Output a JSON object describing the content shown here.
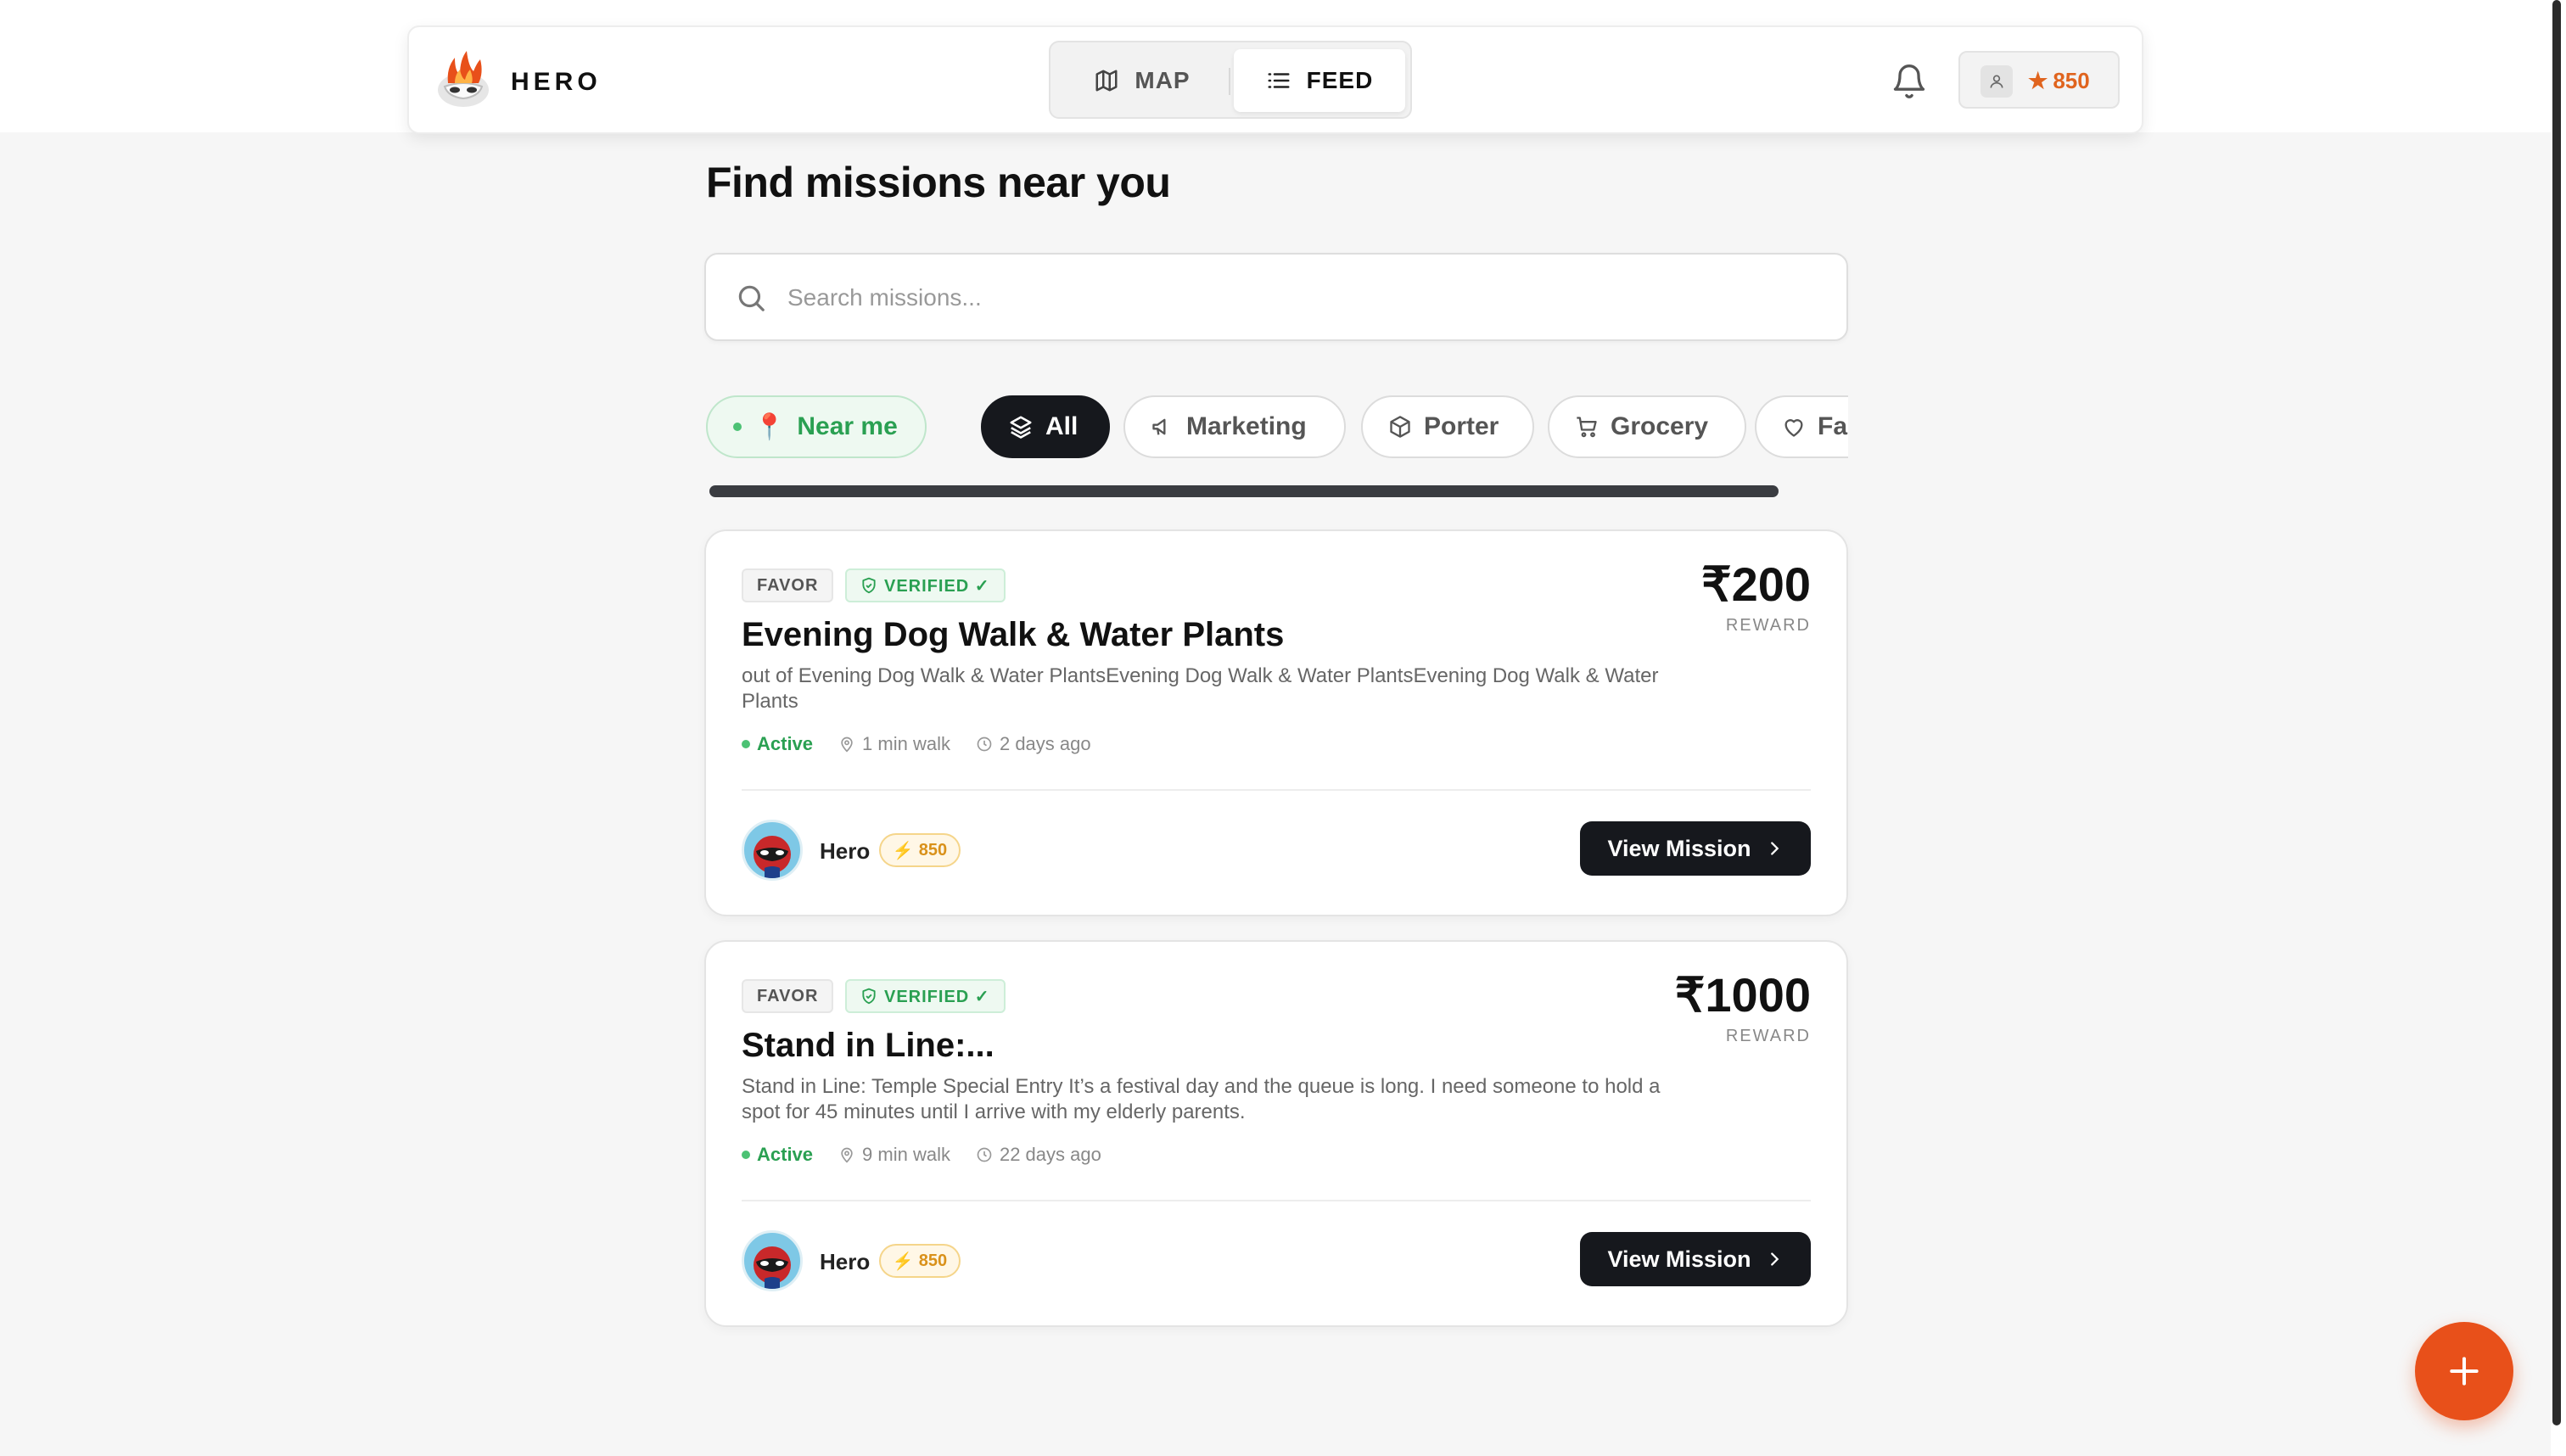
{
  "nav": {
    "brand": "HERO",
    "tabs": [
      {
        "label": "MAP",
        "icon": "map-icon"
      },
      {
        "label": "FEED",
        "icon": "list-icon",
        "active": true
      }
    ],
    "points": "850"
  },
  "heading": "Find missions near you",
  "search": {
    "placeholder": "Search missions..."
  },
  "filters": [
    {
      "label": "Near me",
      "icon": "pin-icon"
    },
    {
      "label": "All",
      "icon": "layers-icon",
      "active": true
    },
    {
      "label": "Marketing",
      "icon": "megaphone-icon"
    },
    {
      "label": "Porter",
      "icon": "box-icon"
    },
    {
      "label": "Grocery",
      "icon": "cart-icon"
    },
    {
      "label": "Fa",
      "icon": "heart-icon"
    }
  ],
  "missions": [
    {
      "category": "FAVOR",
      "verified": "VERIFIED ✓",
      "title": "Evening Dog Walk & Water Plants",
      "description": "out of Evening Dog Walk & Water PlantsEvening Dog Walk & Water PlantsEvening Dog Walk & Water Plants",
      "status": "Active",
      "distance": "1 min walk",
      "posted": "2 days ago",
      "price": "₹200",
      "reward_label": "REWARD",
      "user": "Hero",
      "user_points": "850",
      "cta": "View Mission"
    },
    {
      "category": "FAVOR",
      "verified": "VERIFIED ✓",
      "title": "Stand in Line:...",
      "description": "Stand in Line: Temple Special Entry  It’s a festival day and the queue is long. I need someone to hold a spot for 45 minutes until I arrive with my elderly parents.",
      "status": "Active",
      "distance": "9 min walk",
      "posted": "22 days ago",
      "price": "₹1000",
      "reward_label": "REWARD",
      "user": "Hero",
      "user_points": "850",
      "cta": "View Mission"
    }
  ],
  "colors": {
    "accent": "#e8501a",
    "green": "#2aa052",
    "dark": "#16181d"
  }
}
